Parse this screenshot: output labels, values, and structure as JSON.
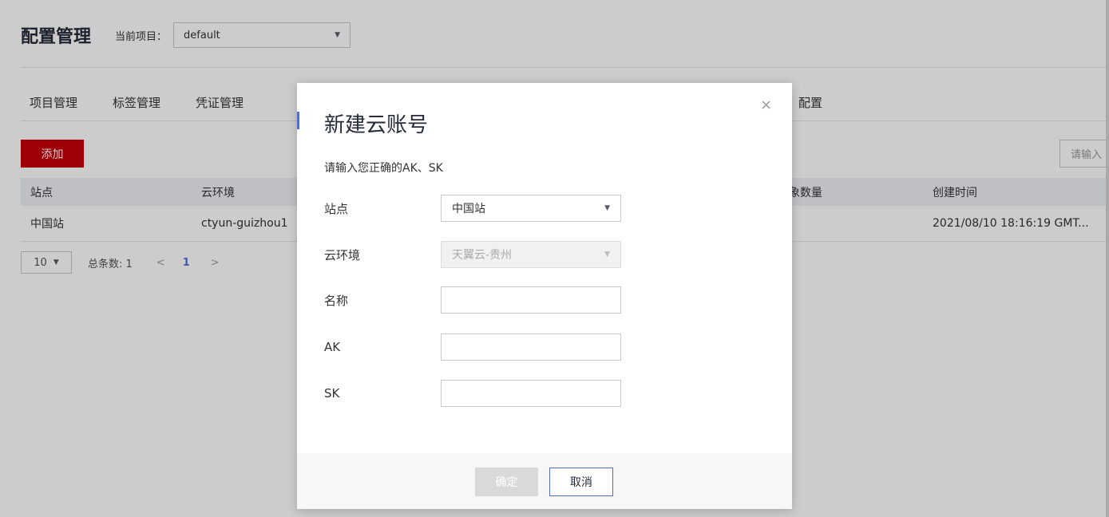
{
  "header": {
    "title": "配置管理",
    "project_label": "当前项目：",
    "project_value": "default"
  },
  "tabs": [
    "项目管理",
    "标签管理",
    "凭证管理"
  ],
  "tab_partial": "配置",
  "toolbar": {
    "add_label": "添加",
    "search_placeholder": "请输入"
  },
  "table": {
    "headers": [
      "站点",
      "云环境",
      "象数量",
      "创建时间"
    ],
    "rows": [
      [
        "中国站",
        "ctyun-guizhou1",
        "2021/08/10 18:16:19 GMT..."
      ]
    ]
  },
  "pager": {
    "page_size": "10",
    "total": "总条数: 1",
    "prev": "<",
    "current_page": "1",
    "next": ">"
  },
  "modal": {
    "title": "新建云账号",
    "close": "×",
    "hint": "请输入您正确的AK、SK",
    "fields": {
      "site": {
        "label": "站点",
        "value": "中国站"
      },
      "cloud_env": {
        "label": "云环境",
        "value": "天翼云-贵州"
      },
      "name": {
        "label": "名称",
        "value": ""
      },
      "ak": {
        "label": "AK",
        "value": ""
      },
      "sk": {
        "label": "SK",
        "value": ""
      }
    },
    "confirm_label": "确定",
    "cancel_label": "取消"
  },
  "colors": {
    "primary_red": "#c7000b",
    "accent_blue": "#526ecc",
    "overlay": "rgba(0,0,0,0.2)"
  }
}
